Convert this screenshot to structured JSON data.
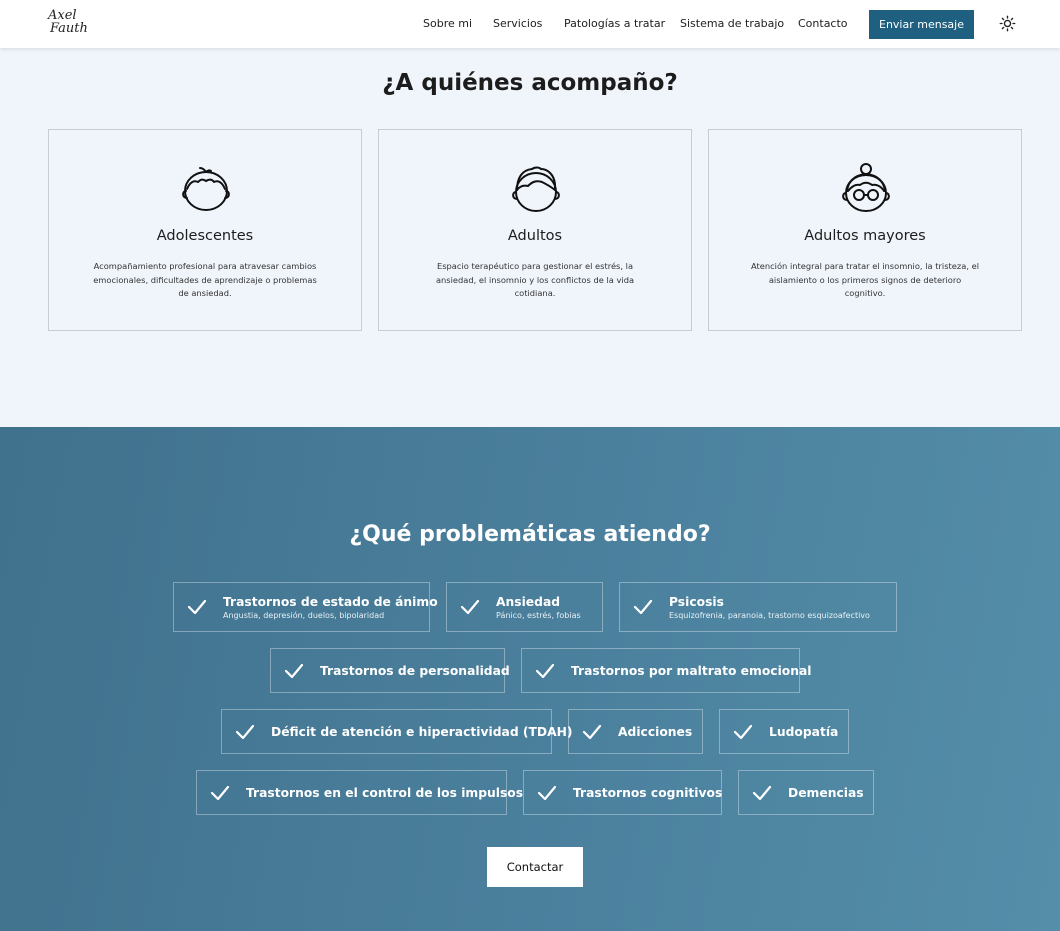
{
  "header": {
    "logo_line1": "Axel",
    "logo_line2": "Fauth",
    "nav": [
      "Sobre mi",
      "Servicios",
      "Patologías a tratar",
      "Sistema de trabajo",
      "Contacto"
    ],
    "cta_label": "Enviar mensaje",
    "theme_icon": "sun-icon"
  },
  "audience": {
    "title": "¿A quiénes acompaño?",
    "cards": [
      {
        "icon": "teen-face-icon",
        "title": "Adolescentes",
        "desc": "Acompañamiento profesional para atravesar cambios emocionales, dificultades de aprendizaje o problemas de ansiedad."
      },
      {
        "icon": "adult-face-icon",
        "title": "Adultos",
        "desc": "Espacio terapéutico para gestionar el estrés, la ansiedad, el insomnio y los conflictos de la vida cotidiana."
      },
      {
        "icon": "elderly-face-icon",
        "title": "Adultos mayores",
        "desc": "Atención integral para tratar el insomnio, la tristeza, el aislamiento o los primeros signos de deterioro cognitivo."
      }
    ]
  },
  "problems": {
    "title": "¿Qué problemáticas atiendo?",
    "items": [
      {
        "label": "Trastornos de estado de ánimo",
        "sub": "Angustia, depresión, duelos, bipolaridad"
      },
      {
        "label": "Ansiedad",
        "sub": "Pánico, estrés, fobias"
      },
      {
        "label": "Psicosis",
        "sub": "Esquizofrenia, paranoia, trastorno esquizoafectivo"
      },
      {
        "label": "Trastornos de personalidad"
      },
      {
        "label": "Trastornos por maltrato emocional"
      },
      {
        "label": "Déficit de atención e hiperactividad (TDAH)"
      },
      {
        "label": "Adicciones"
      },
      {
        "label": "Ludopatía"
      },
      {
        "label": "Trastornos en el control de los impulsos"
      },
      {
        "label": "Trastornos cognitivos"
      },
      {
        "label": "Demencias"
      }
    ],
    "button_label": "Contactar"
  },
  "colors": {
    "accent": "#1f5f7f",
    "page_bg": "#f0f5fc",
    "section_bg_start": "#40718d",
    "section_bg_end": "#548ea9"
  }
}
